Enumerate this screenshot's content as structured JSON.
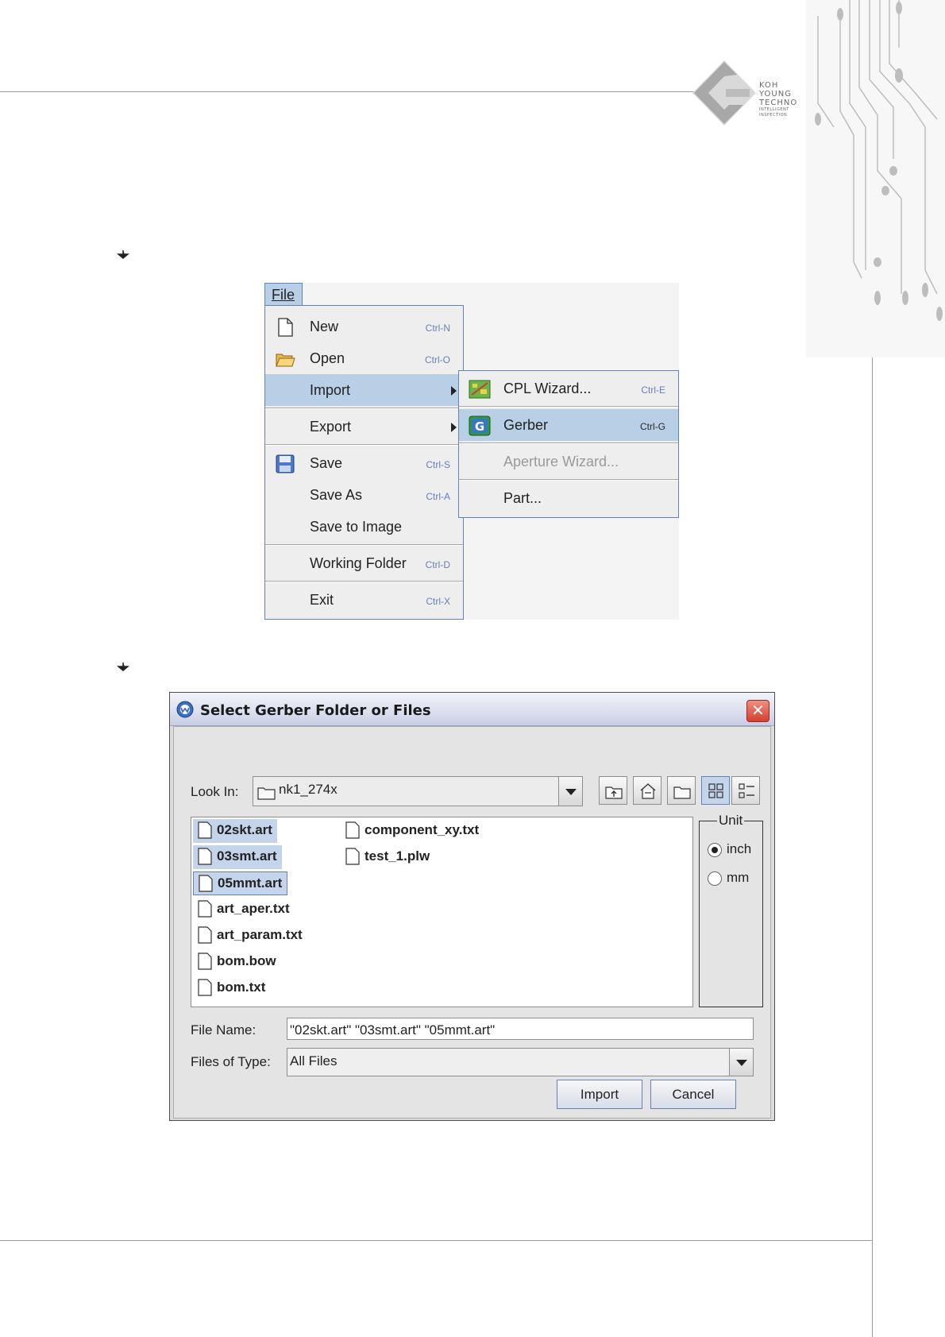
{
  "brand": {
    "logo_name": "koh-young-techno-logo",
    "line1": "KOH",
    "line2": "YOUNG",
    "line3": "TECHNO",
    "line4": "INTELLIGENT",
    "line5": "INSPECTION"
  },
  "file_menu": {
    "title": "File",
    "items": [
      {
        "label": "New",
        "shortcut": "Ctrl-N",
        "icon": "new-file-icon"
      },
      {
        "label": "Open",
        "shortcut": "Ctrl-O",
        "icon": "open-folder-icon"
      },
      {
        "label": "Import",
        "shortcut": "",
        "submenu": true,
        "selected": true
      },
      {
        "label": "Export",
        "shortcut": "",
        "submenu": true
      },
      {
        "label": "Save",
        "shortcut": "Ctrl-S",
        "icon": "save-floppy-icon"
      },
      {
        "label": "Save As",
        "shortcut": "Ctrl-A"
      },
      {
        "label": "Save to Image",
        "shortcut": ""
      },
      {
        "label": "Working Folder",
        "shortcut": "Ctrl-D"
      },
      {
        "label": "Exit",
        "shortcut": "Ctrl-X"
      }
    ]
  },
  "import_submenu": {
    "items": [
      {
        "label": "CPL Wizard...",
        "shortcut": "Ctrl-E",
        "icon": "cpl-wizard-icon"
      },
      {
        "label": "Gerber",
        "shortcut": "Ctrl-G",
        "icon": "gerber-g-icon",
        "selected": true
      },
      {
        "label": "Aperture Wizard...",
        "shortcut": "",
        "disabled": true
      },
      {
        "label": "Part...",
        "shortcut": ""
      }
    ]
  },
  "dialog": {
    "title": "Select Gerber Folder or Files",
    "look_in_label": "Look In:",
    "look_in_value": "nk1_274x",
    "toolbar_icons": [
      "up-folder-icon",
      "home-icon",
      "new-folder-icon",
      "list-view-icon",
      "details-view-icon"
    ],
    "files": [
      {
        "name": "02skt.art",
        "selected": true
      },
      {
        "name": "03smt.art",
        "selected": true
      },
      {
        "name": "05mmt.art",
        "selected": true,
        "focused": true
      },
      {
        "name": "art_aper.txt"
      },
      {
        "name": "art_param.txt"
      },
      {
        "name": "bom.bow"
      },
      {
        "name": "bom.txt"
      },
      {
        "name": "component_xy.txt"
      },
      {
        "name": "test_1.plw"
      }
    ],
    "unit_group": {
      "legend": "Unit",
      "options": [
        "inch",
        "mm"
      ],
      "selected": "inch"
    },
    "file_name_label": "File Name:",
    "file_name_value": "\"02skt.art\" \"03smt.art\" \"05mmt.art\"",
    "files_of_type_label": "Files of Type:",
    "files_of_type_value": "All Files",
    "import_button": "Import",
    "cancel_button": "Cancel",
    "close_symbol": "✕"
  },
  "colors": {
    "menu_highlight": "#b8cfe5",
    "menu_border": "#6382bf",
    "shortcut_text": "#6a7fb6",
    "close_button": "#d3402f"
  }
}
